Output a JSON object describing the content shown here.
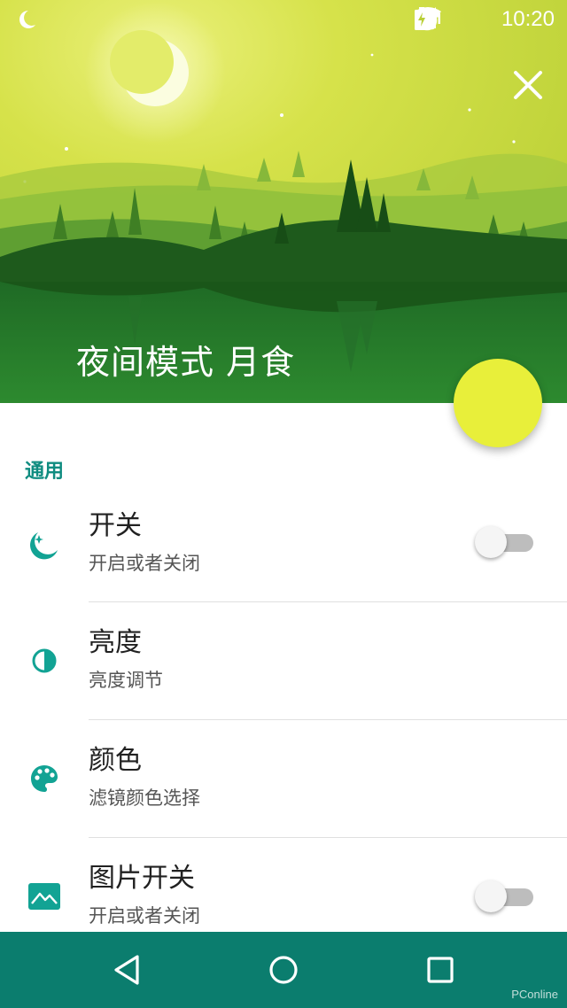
{
  "status_bar": {
    "time": "10:20"
  },
  "header": {
    "title": "夜间模式 月食"
  },
  "section": {
    "label": "通用"
  },
  "settings": [
    {
      "title": "开关",
      "subtitle": "开启或者关闭",
      "icon": "moon-stars-icon",
      "toggle": false
    },
    {
      "title": "亮度",
      "subtitle": "亮度调节",
      "icon": "half-circle-icon"
    },
    {
      "title": "颜色",
      "subtitle": "滤镜颜色选择",
      "icon": "palette-icon"
    },
    {
      "title": "图片开关",
      "subtitle": "开启或者关闭",
      "icon": "image-icon",
      "toggle": false
    }
  ],
  "watermark": "PConline",
  "colors": {
    "accent": "#0f8c80",
    "fab": "#e8ef3a",
    "navbar": "#0b7d6e",
    "header_sky": "#c6d83a"
  }
}
